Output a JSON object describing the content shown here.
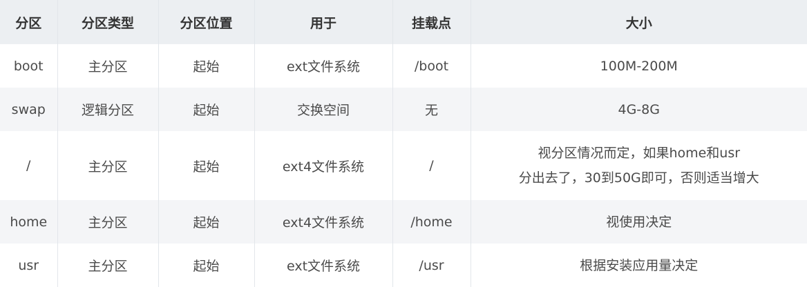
{
  "table": {
    "headers": [
      "分区",
      "分区类型",
      "分区位置",
      "用于",
      "挂载点",
      "大小"
    ],
    "rows": [
      {
        "partition": "boot",
        "type": "主分区",
        "position": "起始",
        "usage": "ext文件系统",
        "mount": "/boot",
        "size": [
          "100M-200M"
        ]
      },
      {
        "partition": "swap",
        "type": "逻辑分区",
        "position": "起始",
        "usage": "交换空间",
        "mount": "无",
        "size": [
          "4G-8G"
        ]
      },
      {
        "partition": "/",
        "type": "主分区",
        "position": "起始",
        "usage": "ext4文件系统",
        "mount": "/",
        "size": [
          "视分区情况而定，如果home和usr",
          "分出去了，30到50G即可，否则适当增大"
        ]
      },
      {
        "partition": "home",
        "type": "主分区",
        "position": "起始",
        "usage": "ext4文件系统",
        "mount": "/home",
        "size": [
          "视使用决定"
        ]
      },
      {
        "partition": "usr",
        "type": "主分区",
        "position": "起始",
        "usage": "ext文件系统",
        "mount": "/usr",
        "size": [
          "根据安装应用量决定"
        ]
      }
    ]
  }
}
